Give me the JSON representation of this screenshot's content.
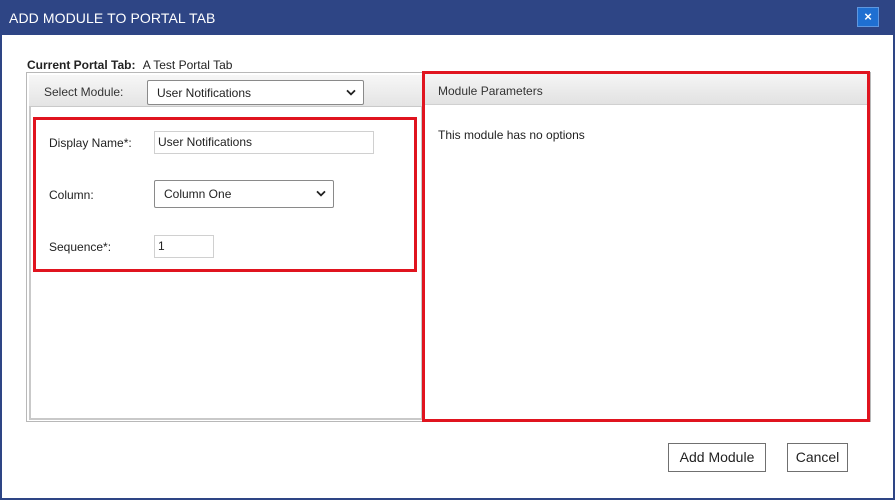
{
  "window": {
    "title": "ADD MODULE TO PORTAL TAB",
    "close_label": "×",
    "accent_color": "#2e4585"
  },
  "current_tab": {
    "label": "Current Portal Tab:",
    "value": "A Test Portal Tab"
  },
  "module_select": {
    "label": "Select Module:",
    "selected": "User Notifications"
  },
  "form": {
    "display_name_label": "Display Name*:",
    "display_name_value": "User Notifications",
    "column_label": "Column:",
    "column_selected": "Column One",
    "sequence_label": "Sequence*:",
    "sequence_value": "1"
  },
  "params": {
    "header": "Module Parameters",
    "message": "This module has no options"
  },
  "buttons": {
    "add": "Add Module",
    "cancel": "Cancel"
  },
  "highlight_color": "#e0141f"
}
